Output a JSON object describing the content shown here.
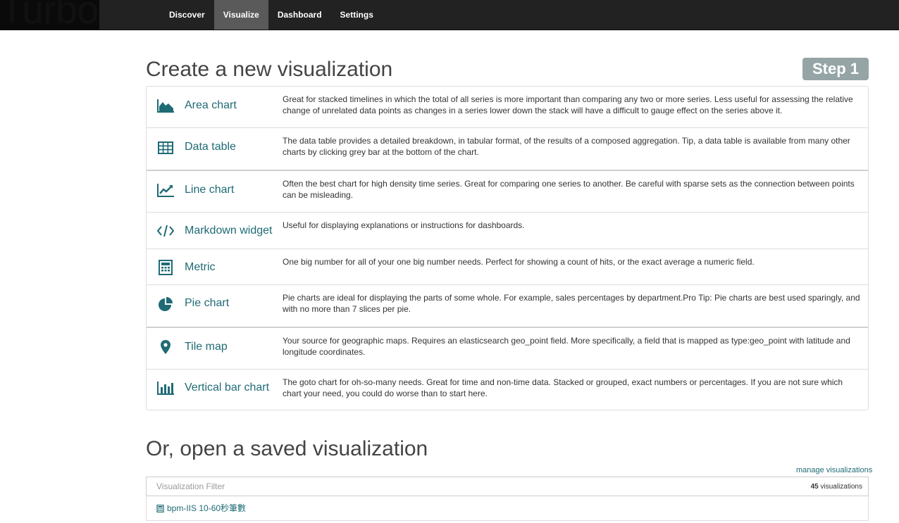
{
  "brand": {
    "name": "Turbo"
  },
  "nav": {
    "tabs": [
      {
        "label": "Discover",
        "active": false
      },
      {
        "label": "Visualize",
        "active": true
      },
      {
        "label": "Dashboard",
        "active": false
      },
      {
        "label": "Settings",
        "active": false
      }
    ]
  },
  "create": {
    "heading": "Create a new visualization",
    "step_badge": "Step 1",
    "types": [
      {
        "icon": "area-chart-icon",
        "title": "Area chart",
        "description": "Great for stacked timelines in which the total of all series is more important than comparing any two or more series. Less useful for assessing the relative change of unrelated data points as changes in a series lower down the stack will have a difficult to gauge effect on the series above it."
      },
      {
        "icon": "table-icon",
        "title": "Data table",
        "description": "The data table provides a detailed breakdown, in tabular format, of the results of a composed aggregation. Tip, a data table is available from many other charts by clicking grey bar at the bottom of the chart."
      },
      {
        "icon": "line-chart-icon",
        "title": "Line chart",
        "description": "Often the best chart for high density time series. Great for comparing one series to another. Be careful with sparse sets as the connection between points can be misleading."
      },
      {
        "icon": "code-icon",
        "title": "Markdown widget",
        "description": "Useful for displaying explanations or instructions for dashboards."
      },
      {
        "icon": "calculator-icon",
        "title": "Metric",
        "description": "One big number for all of your one big number needs. Perfect for showing a count of hits, or the exact average a numeric field."
      },
      {
        "icon": "pie-chart-icon",
        "title": "Pie chart",
        "description": "Pie charts are ideal for displaying the parts of some whole. For example, sales percentages by department.Pro Tip: Pie charts are best used sparingly, and with no more than 7 slices per pie."
      },
      {
        "icon": "map-marker-icon",
        "title": "Tile map",
        "description": "Your source for geographic maps. Requires an elasticsearch geo_point field. More specifically, a field that is mapped as type:geo_point with latitude and longitude coordinates."
      },
      {
        "icon": "bar-chart-icon",
        "title": "Vertical bar chart",
        "description": "The goto chart for oh-so-many needs. Great for time and non-time data. Stacked or grouped, exact numbers or percentages. If you are not sure which chart your need, you could do worse than to start here."
      }
    ]
  },
  "saved": {
    "heading": "Or, open a saved visualization",
    "manage_link": "manage visualizations",
    "filter_placeholder": "Visualization Filter",
    "count_number": "45",
    "count_label": " visualizations",
    "items": [
      {
        "icon": "calculator-icon",
        "title": "bpm-IIS 10-60秒筆數"
      }
    ]
  },
  "colors": {
    "accent": "#1f6b75",
    "navbar": "#222222",
    "badge": "#95a5a6"
  }
}
